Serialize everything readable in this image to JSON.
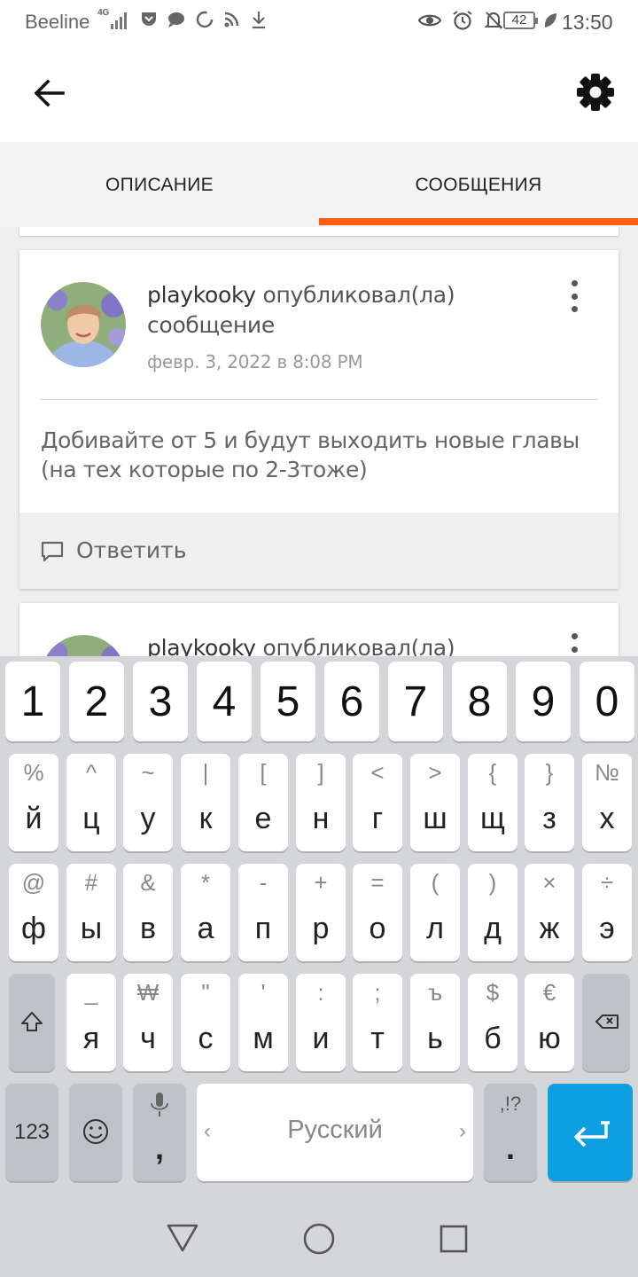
{
  "status_bar": {
    "carrier": "Beeline",
    "network": "4G",
    "battery": "42",
    "time": "13:50"
  },
  "tabs": [
    {
      "label": "ОПИСАНИЕ",
      "active": false
    },
    {
      "label": "СООБЩЕНИЯ",
      "active": true
    }
  ],
  "colors": {
    "accent": "#ff5e10",
    "enter_key": "#0d9fe2"
  },
  "messages": [
    {
      "author": "playkooky",
      "action": "опубликовал(ла) сообщение",
      "date": "февр. 3, 2022 в 8:08 PM",
      "text": "Добивайте от 5 и будут выходить новые главы (на тех которые по 2-3тоже)",
      "reply_label": "Ответить"
    },
    {
      "author": "playkooky",
      "action": "опубликовал(ла)"
    }
  ],
  "keyboard": {
    "numbers": [
      "1",
      "2",
      "3",
      "4",
      "5",
      "6",
      "7",
      "8",
      "9",
      "0"
    ],
    "row1": [
      {
        "pri": "й",
        "sec": "%"
      },
      {
        "pri": "ц",
        "sec": "^"
      },
      {
        "pri": "у",
        "sec": "~"
      },
      {
        "pri": "к",
        "sec": "|"
      },
      {
        "pri": "е",
        "sec": "["
      },
      {
        "pri": "н",
        "sec": "]"
      },
      {
        "pri": "г",
        "sec": "<"
      },
      {
        "pri": "ш",
        "sec": ">"
      },
      {
        "pri": "щ",
        "sec": "{"
      },
      {
        "pri": "з",
        "sec": "}"
      },
      {
        "pri": "х",
        "sec": "№"
      }
    ],
    "row2": [
      {
        "pri": "ф",
        "sec": "@"
      },
      {
        "pri": "ы",
        "sec": "#"
      },
      {
        "pri": "в",
        "sec": "&"
      },
      {
        "pri": "а",
        "sec": "*"
      },
      {
        "pri": "п",
        "sec": "-"
      },
      {
        "pri": "р",
        "sec": "+"
      },
      {
        "pri": "о",
        "sec": "="
      },
      {
        "pri": "л",
        "sec": "("
      },
      {
        "pri": "д",
        "sec": ")"
      },
      {
        "pri": "ж",
        "sec": "×"
      },
      {
        "pri": "э",
        "sec": "÷"
      }
    ],
    "row3": [
      {
        "pri": "я",
        "sec": "_"
      },
      {
        "pri": "ч",
        "sec": "₩"
      },
      {
        "pri": "с",
        "sec": "\""
      },
      {
        "pri": "м",
        "sec": "'"
      },
      {
        "pri": "и",
        "sec": ":"
      },
      {
        "pri": "т",
        "sec": ";"
      },
      {
        "pri": "ь",
        "sec": "ъ"
      },
      {
        "pri": "б",
        "sec": "$"
      },
      {
        "pri": "ю",
        "sec": "€"
      }
    ],
    "symbols_label": "123",
    "comma": ",",
    "space_label": "Русский",
    "space_left_arrow": "‹",
    "space_right_arrow": "›",
    "period": ".",
    "period_sec": ",!?"
  },
  "icons": [
    "back-arrow-icon",
    "gear-icon",
    "more-vert-icon",
    "comment-icon",
    "shift-icon",
    "backspace-icon",
    "emoji-icon",
    "mic-icon",
    "enter-icon",
    "nav-back-icon",
    "nav-home-icon",
    "nav-recents-icon"
  ]
}
